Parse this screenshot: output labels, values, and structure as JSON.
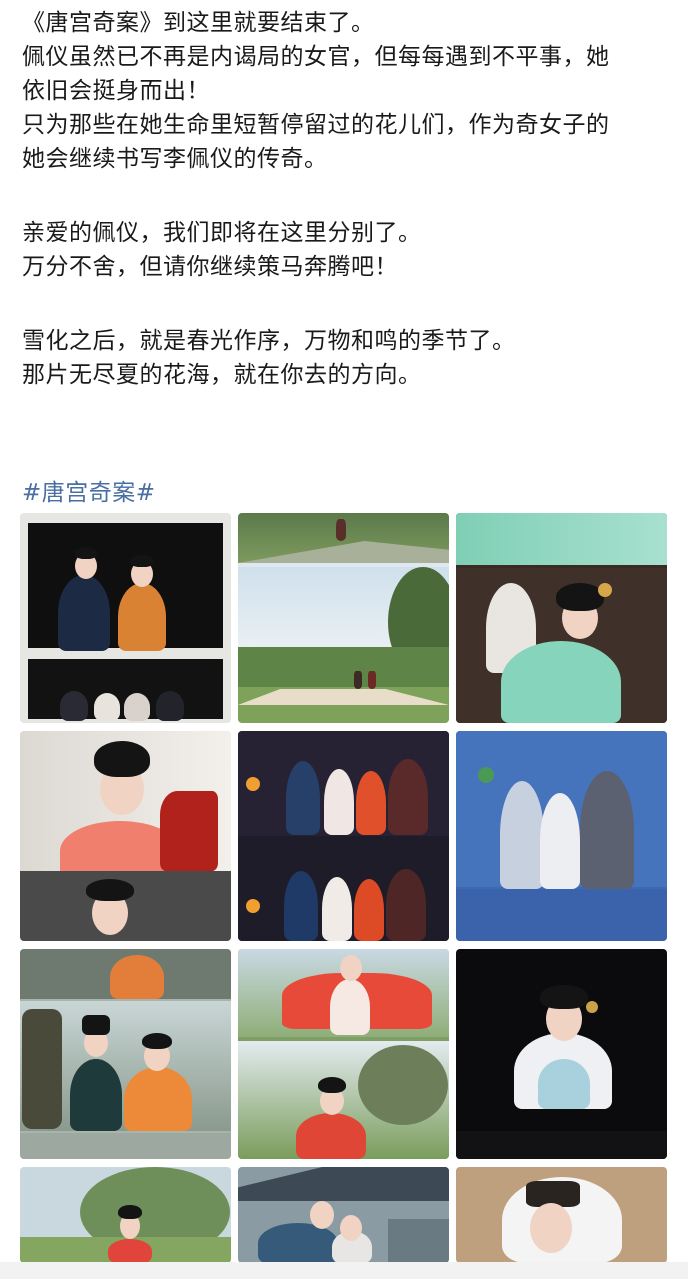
{
  "post": {
    "lines": [
      "《唐宫奇案》到这里就要结束了。",
      "佩仪虽然已不再是内谒局的女官，但每每遇到不平事，她",
      "依旧会挺身而出！",
      "只为那些在她生命里短暂停留过的花儿们，作为奇女子的",
      "她会继续书写李佩仪的传奇。",
      "亲爱的佩仪，我们即将在这里分别了。",
      "万分不舍，但请你继续策马奔腾吧！",
      "雪化之后，就是春光作序，万物和鸣的季节了。",
      "那片无尽夏的花海，就在你去的方向。"
    ],
    "hashtag": "#唐宫奇案#"
  },
  "colors": {
    "hashtag": "#4a6ea1",
    "text": "#1a1a1a"
  },
  "photos": [
    {
      "name": "polaroid-couple-dark-robes"
    },
    {
      "name": "horse-riding-meadow"
    },
    {
      "name": "teal-robe-actress"
    },
    {
      "name": "actress-red-dress-makeup"
    },
    {
      "name": "group-cast-photo"
    },
    {
      "name": "blue-backdrop-trio"
    },
    {
      "name": "orange-robe-couple"
    },
    {
      "name": "red-sleeves-dancing"
    },
    {
      "name": "fur-collar-portrait"
    },
    {
      "name": "willow-tree-portrait"
    },
    {
      "name": "courtyard-duo"
    },
    {
      "name": "white-veil-portrait"
    }
  ]
}
